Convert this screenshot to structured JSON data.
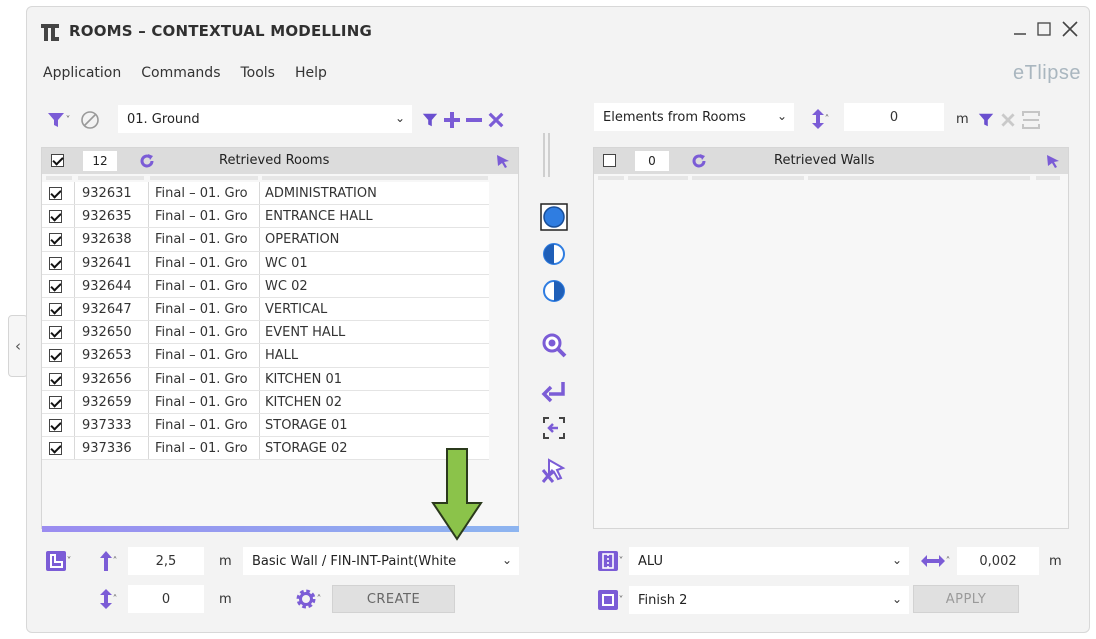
{
  "window": {
    "title": "ROOMS – CONTEXTUAL MODELLING",
    "brand": "eTlipse",
    "menu": [
      "Application",
      "Commands",
      "Tools",
      "Help"
    ]
  },
  "left": {
    "level_combo": "01. Ground",
    "panel_title": "Retrieved Rooms",
    "count": "12",
    "rows": [
      {
        "checked": true,
        "id": "932631",
        "level": "Final – 01. Gro",
        "name": "ADMINISTRATION"
      },
      {
        "checked": true,
        "id": "932635",
        "level": "Final – 01. Gro",
        "name": "ENTRANCE HALL"
      },
      {
        "checked": true,
        "id": "932638",
        "level": "Final – 01. Gro",
        "name": "OPERATION"
      },
      {
        "checked": true,
        "id": "932641",
        "level": "Final – 01. Gro",
        "name": "WC 01"
      },
      {
        "checked": true,
        "id": "932644",
        "level": "Final – 01. Gro",
        "name": "WC 02"
      },
      {
        "checked": true,
        "id": "932647",
        "level": "Final – 01. Gro",
        "name": "VERTICAL"
      },
      {
        "checked": true,
        "id": "932650",
        "level": "Final – 01. Gro",
        "name": "EVENT HALL"
      },
      {
        "checked": true,
        "id": "932653",
        "level": "Final – 01. Gro",
        "name": "HALL"
      },
      {
        "checked": true,
        "id": "932656",
        "level": "Final – 01. Gro",
        "name": "KITCHEN 01"
      },
      {
        "checked": true,
        "id": "932659",
        "level": "Final – 01. Gro",
        "name": "KITCHEN 02"
      },
      {
        "checked": true,
        "id": "937333",
        "level": "Final – 01. Gro",
        "name": "STORAGE 01"
      },
      {
        "checked": true,
        "id": "937336",
        "level": "Final – 01. Gro",
        "name": "STORAGE 02"
      }
    ],
    "height_value": "2,5",
    "offset_value": "0",
    "unit": "m",
    "wall_type": "Basic Wall / FIN-INT-Paint(White",
    "create_label": "CREATE"
  },
  "right": {
    "source_combo": "Elements from Rooms",
    "offset_value": "0",
    "unit": "m",
    "panel_title": "Retrieved Walls",
    "count": "0",
    "material": "ALU",
    "thickness": "0,002",
    "finish": "Finish 2",
    "apply_label": "APPLY"
  },
  "colors": {
    "accent_purple": "#7b5cd6",
    "accent_blue": "#2f7de1",
    "arrow_green": "#8bc34a"
  }
}
